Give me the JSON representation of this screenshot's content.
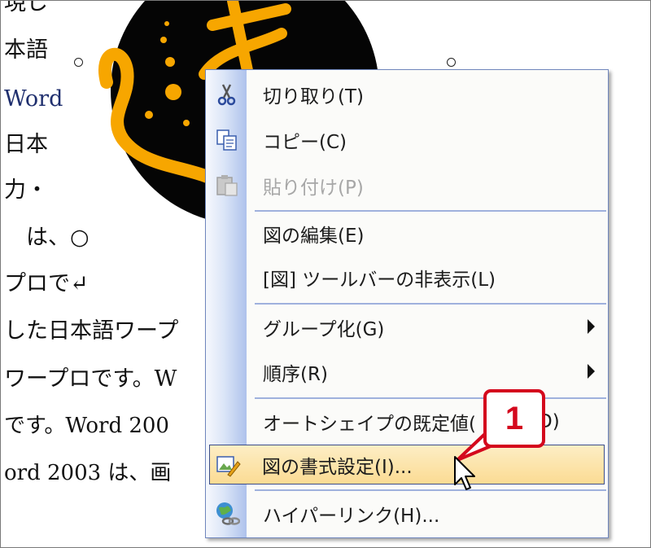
{
  "document": {
    "lines": [
      "現し",
      "本語",
      "Word",
      "日本",
      "力・",
      "　は、○",
      "プロで↵",
      "した日本語ワープ",
      "ワープロです。W",
      "です。Word 200",
      "ord 2003 は、画"
    ]
  },
  "context_menu": {
    "items": [
      {
        "label": "切り取り(T)",
        "icon": "scissors-icon",
        "enabled": true
      },
      {
        "label": "コピー(C)",
        "icon": "copy-icon",
        "enabled": true
      },
      {
        "label": "貼り付け(P)",
        "icon": "paste-icon",
        "enabled": false
      },
      {
        "label": "図の編集(E)",
        "enabled": true
      },
      {
        "label": "[図] ツールバーの非表示(L)",
        "enabled": true
      },
      {
        "label": "グループ化(G)",
        "submenu": true,
        "enabled": true
      },
      {
        "label": "順序(R)",
        "submenu": true,
        "enabled": true
      },
      {
        "label": "オートシェイプの既定値(",
        "label_suffix": "D)",
        "enabled": true
      },
      {
        "label": "図の書式設定(I)...",
        "icon": "format-picture-icon",
        "enabled": true,
        "highlighted": true
      },
      {
        "label": "ハイパーリンク(H)...",
        "icon": "hyperlink-globe-icon",
        "enabled": true
      }
    ]
  },
  "callout": {
    "number": "1",
    "color": "#d4081d"
  },
  "colors": {
    "menu_border": "#6f86bd",
    "highlight_top": "#fdeec5",
    "highlight_bottom": "#fbdb93",
    "clipart_gold": "#f7a600"
  }
}
